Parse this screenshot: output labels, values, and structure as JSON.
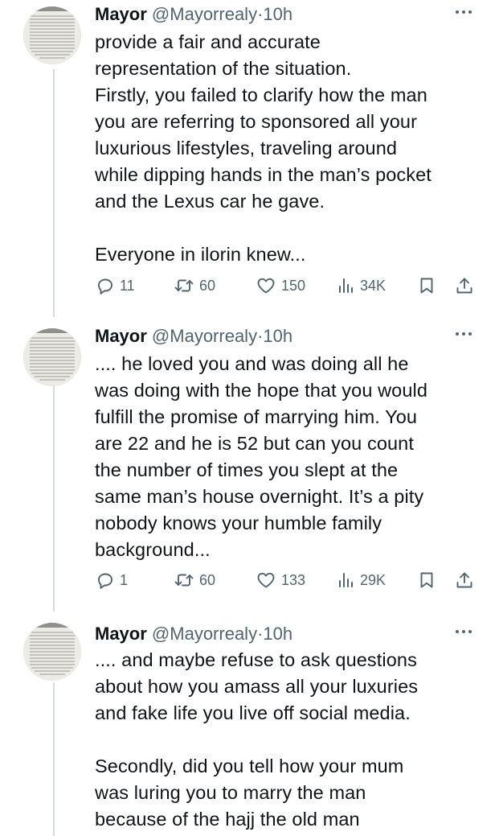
{
  "tweets": [
    {
      "name": "Mayor",
      "handle": "@Mayorrealy",
      "separator": "·",
      "time": "10h",
      "text": "provide a fair and accurate\nrepresentation of the situation.\nFirstly, you failed to clarify how the man\nyou are referring to sponsored all your\nluxurious lifestyles, traveling around\nwhile dipping hands in the man’s pocket\nand the Lexus car he gave.\n\nEveryone in ilorin knew...",
      "replies": "11",
      "reposts": "60",
      "likes": "150",
      "views": "34K"
    },
    {
      "name": "Mayor",
      "handle": "@Mayorrealy",
      "separator": "·",
      "time": "10h",
      "text": ".... he loved you and was doing  all he\nwas doing with the hope that you would\nfulfill the promise of marrying him. You\nare 22 and he is 52 but can you count\nthe number of times you slept at the\nsame man’s house overnight. It’s a pity\nnobody knows your humble family\nbackground...",
      "replies": "1",
      "reposts": "60",
      "likes": "133",
      "views": "29K"
    },
    {
      "name": "Mayor",
      "handle": "@Mayorrealy",
      "separator": "·",
      "time": "10h",
      "text": ".... and maybe refuse to ask questions\nabout how you amass  all your luxuries\nand fake life you live off social media.\n\nSecondly, did you tell how your mum\nwas luring you to marry the man\nbecause of the hajj the old man"
    }
  ],
  "icons": {
    "more": "more-horizontal-icon",
    "reply": "reply-bubble-icon",
    "repost": "repost-arrows-icon",
    "like": "heart-icon",
    "views": "bar-chart-icon",
    "bookmark": "bookmark-icon",
    "share": "share-upload-icon"
  },
  "colors": {
    "text": "#0f1419",
    "secondary": "#536471",
    "thread_line": "#cfd9de"
  }
}
